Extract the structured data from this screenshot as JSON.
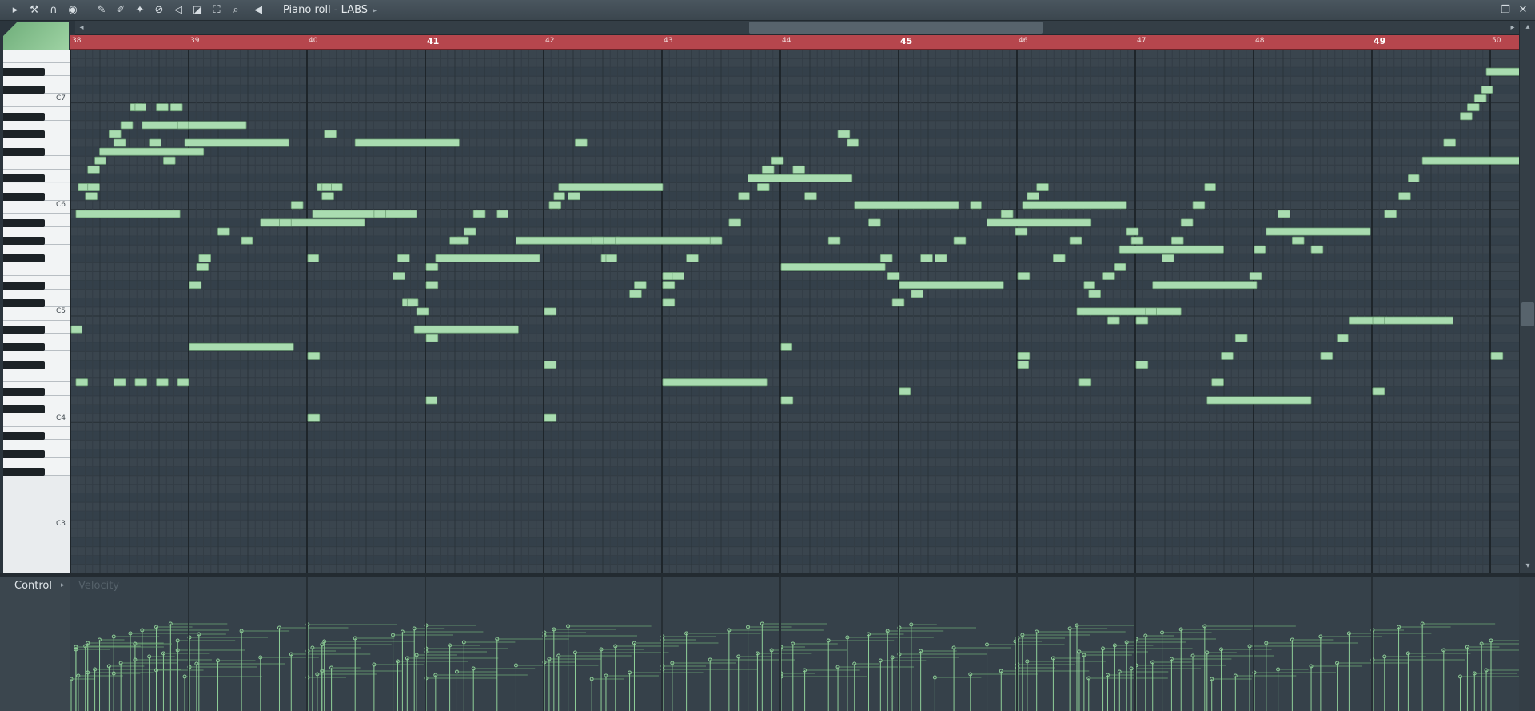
{
  "window": {
    "title": "Piano roll - LABS"
  },
  "toolbar": [
    "menu-arrow-icon",
    "wrench-icon",
    "magnet-icon",
    "record-icon",
    "pencil-icon",
    "paint-icon",
    "delete-tool-icon",
    "mute-tool-icon",
    "slice-icon",
    "select-icon",
    "zoom-icon",
    "playback-icon",
    "speaker-icon"
  ],
  "piano": {
    "labels": [
      "C7",
      "C6",
      "C5",
      "C4",
      "C3"
    ]
  },
  "ruler": {
    "bars": [
      "38",
      "39",
      "40",
      "41",
      "42",
      "43",
      "44",
      "45",
      "46",
      "47",
      "48",
      "49",
      "50"
    ]
  },
  "control": {
    "label": "Control",
    "target": "Velocity"
  },
  "colors": {
    "note": "#a9dcb0",
    "ruler": "#b6464d",
    "grid": "#3a454e"
  },
  "notes": [
    [
      38.0,
      46
    ],
    [
      38.04,
      59
    ],
    [
      38.06,
      62
    ],
    [
      38.12,
      61
    ],
    [
      38.14,
      62
    ],
    [
      38.14,
      64
    ],
    [
      38.2,
      65
    ],
    [
      38.24,
      66
    ],
    [
      38.32,
      68
    ],
    [
      38.36,
      67
    ],
    [
      38.42,
      69
    ],
    [
      38.5,
      71
    ],
    [
      38.54,
      71
    ],
    [
      38.6,
      69
    ],
    [
      38.66,
      67
    ],
    [
      38.72,
      71
    ],
    [
      38.78,
      65
    ],
    [
      38.84,
      71
    ],
    [
      38.9,
      69
    ],
    [
      38.96,
      67
    ],
    [
      38.04,
      40
    ],
    [
      38.36,
      40
    ],
    [
      38.54,
      40
    ],
    [
      38.72,
      40
    ],
    [
      38.9,
      40
    ],
    [
      39.0,
      44
    ],
    [
      39.0,
      51
    ],
    [
      39.06,
      53
    ],
    [
      39.08,
      54
    ],
    [
      39.24,
      57
    ],
    [
      39.44,
      56
    ],
    [
      39.6,
      58
    ],
    [
      39.76,
      58
    ],
    [
      39.86,
      60
    ],
    [
      40.0,
      43
    ],
    [
      40.0,
      36
    ],
    [
      40.0,
      54
    ],
    [
      40.04,
      59
    ],
    [
      40.08,
      62
    ],
    [
      40.12,
      61
    ],
    [
      40.12,
      62
    ],
    [
      40.14,
      68
    ],
    [
      40.2,
      62
    ],
    [
      40.4,
      67
    ],
    [
      40.56,
      59
    ],
    [
      40.72,
      52
    ],
    [
      40.76,
      54
    ],
    [
      40.8,
      49
    ],
    [
      40.84,
      49
    ],
    [
      40.9,
      46
    ],
    [
      40.92,
      48
    ],
    [
      41.0,
      51
    ],
    [
      41.0,
      53
    ],
    [
      41.0,
      45
    ],
    [
      41.0,
      38
    ],
    [
      41.08,
      54
    ],
    [
      41.2,
      56
    ],
    [
      41.26,
      56
    ],
    [
      41.32,
      57
    ],
    [
      41.4,
      59
    ],
    [
      41.6,
      59
    ],
    [
      41.76,
      56
    ],
    [
      42.0,
      36
    ],
    [
      42.0,
      42
    ],
    [
      42.0,
      48
    ],
    [
      42.04,
      60
    ],
    [
      42.08,
      61
    ],
    [
      42.12,
      62
    ],
    [
      42.2,
      61
    ],
    [
      42.26,
      67
    ],
    [
      42.4,
      56
    ],
    [
      42.48,
      54
    ],
    [
      42.52,
      54
    ],
    [
      42.6,
      56
    ],
    [
      42.72,
      50
    ],
    [
      42.76,
      51
    ],
    [
      43.0,
      49
    ],
    [
      43.0,
      51
    ],
    [
      43.0,
      52
    ],
    [
      43.0,
      40
    ],
    [
      43.08,
      52
    ],
    [
      43.2,
      54
    ],
    [
      43.4,
      56
    ],
    [
      43.56,
      58
    ],
    [
      43.64,
      61
    ],
    [
      43.72,
      63
    ],
    [
      43.8,
      62
    ],
    [
      43.84,
      64
    ],
    [
      43.92,
      65
    ],
    [
      44.0,
      38
    ],
    [
      44.0,
      44
    ],
    [
      44.0,
      53
    ],
    [
      44.1,
      64
    ],
    [
      44.2,
      61
    ],
    [
      44.4,
      56
    ],
    [
      44.48,
      68
    ],
    [
      44.56,
      67
    ],
    [
      44.62,
      60
    ],
    [
      44.74,
      58
    ],
    [
      44.84,
      54
    ],
    [
      44.9,
      52
    ],
    [
      44.94,
      49
    ],
    [
      45.0,
      39
    ],
    [
      45.0,
      51
    ],
    [
      45.1,
      50
    ],
    [
      45.18,
      54
    ],
    [
      45.3,
      54
    ],
    [
      45.46,
      56
    ],
    [
      45.6,
      60
    ],
    [
      45.74,
      58
    ],
    [
      45.86,
      59
    ],
    [
      45.98,
      57
    ],
    [
      46.0,
      52
    ],
    [
      46.0,
      43
    ],
    [
      46.0,
      42
    ],
    [
      46.04,
      60
    ],
    [
      46.08,
      61
    ],
    [
      46.16,
      62
    ],
    [
      46.3,
      54
    ],
    [
      46.44,
      56
    ],
    [
      46.56,
      51
    ],
    [
      46.5,
      48
    ],
    [
      46.52,
      40
    ],
    [
      46.6,
      50
    ],
    [
      46.72,
      52
    ],
    [
      46.76,
      47
    ],
    [
      46.82,
      53
    ],
    [
      46.86,
      55
    ],
    [
      46.92,
      57
    ],
    [
      46.96,
      56
    ],
    [
      47.0,
      47
    ],
    [
      47.0,
      42
    ],
    [
      47.08,
      48
    ],
    [
      47.14,
      51
    ],
    [
      47.22,
      54
    ],
    [
      47.3,
      56
    ],
    [
      47.38,
      58
    ],
    [
      47.48,
      60
    ],
    [
      47.58,
      62
    ],
    [
      47.6,
      38
    ],
    [
      47.64,
      40
    ],
    [
      47.72,
      43
    ],
    [
      47.84,
      45
    ],
    [
      47.96,
      52
    ],
    [
      48.0,
      55
    ],
    [
      48.1,
      57
    ],
    [
      48.2,
      59
    ],
    [
      48.32,
      56
    ],
    [
      48.48,
      55
    ],
    [
      48.56,
      43
    ],
    [
      48.7,
      45
    ],
    [
      48.8,
      47
    ],
    [
      49.0,
      39
    ],
    [
      49.0,
      47
    ],
    [
      49.1,
      59
    ],
    [
      49.22,
      61
    ],
    [
      49.3,
      63
    ],
    [
      49.42,
      65
    ],
    [
      49.6,
      67
    ],
    [
      49.74,
      70
    ],
    [
      49.8,
      71
    ],
    [
      49.86,
      72
    ],
    [
      49.92,
      73
    ],
    [
      49.96,
      75
    ],
    [
      50.0,
      43
    ]
  ]
}
